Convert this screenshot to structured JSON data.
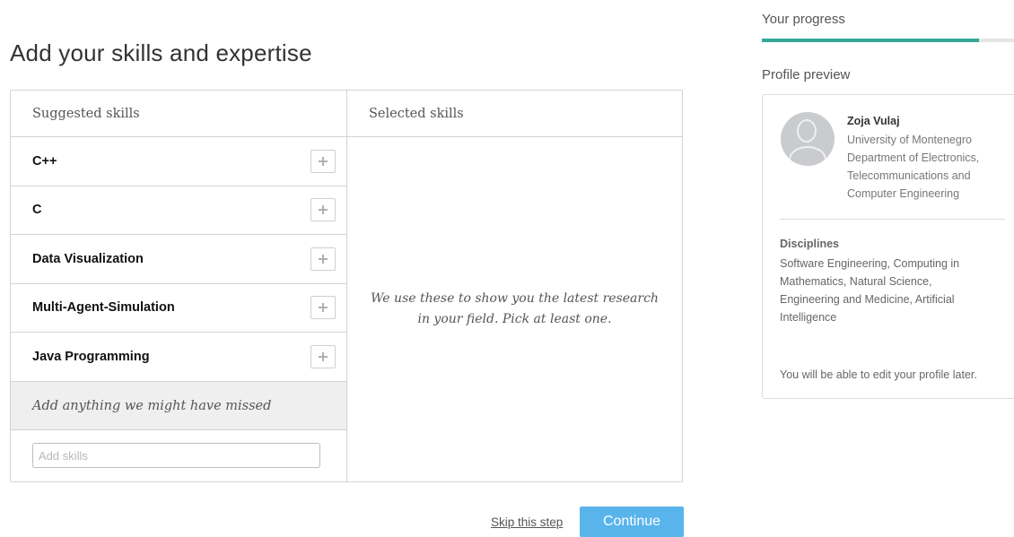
{
  "page": {
    "title": "Add your skills and expertise"
  },
  "suggested": {
    "header": "Suggested skills",
    "items": [
      {
        "label": "C++"
      },
      {
        "label": "C"
      },
      {
        "label": "Data Visualization"
      },
      {
        "label": "Multi-Agent-Simulation"
      },
      {
        "label": "Java Programming"
      }
    ],
    "add_icon": "plus-icon",
    "missed_label": "Add anything we might have missed",
    "input_placeholder": "Add skills",
    "input_value": ""
  },
  "selected": {
    "header": "Selected skills",
    "hint": "We use these to show you the latest research in your field. Pick at least one."
  },
  "actions": {
    "skip_label": "Skip this step",
    "continue_label": "Continue",
    "continue_color": "#5ab4ec"
  },
  "sidebar": {
    "progress_label": "Your progress",
    "progress_fraction": 0.86,
    "progress_color": "#33a898",
    "preview_label": "Profile preview",
    "profile": {
      "avatar_icon": "user-avatar-icon",
      "name": "Zoja Vulaj",
      "affiliation": "University of Montenegro Department of Electronics, Telecommunications and Computer Engineering",
      "disciplines_title": "Disciplines",
      "disciplines": "Software Engineering, Computing in Mathematics, Natural Science, Engineering and Medicine, Artificial Intelligence",
      "edit_note": "You will be able to edit your profile later."
    }
  }
}
